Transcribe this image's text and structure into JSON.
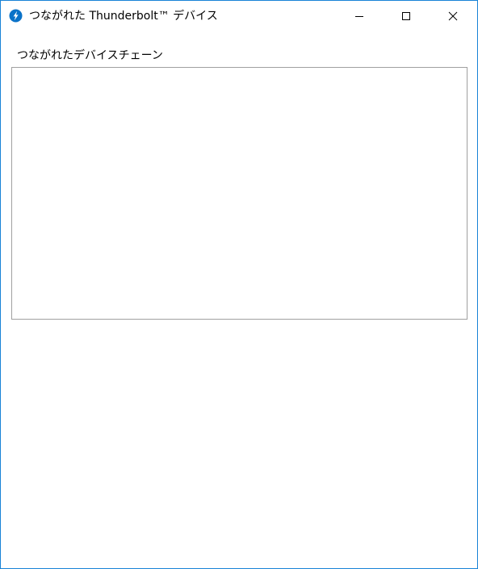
{
  "window": {
    "title": "つながれた Thunderbolt™ デバイス",
    "icon": "thunderbolt-icon",
    "accent_color": "#1883d7",
    "controls": {
      "minimize": "minimize-icon",
      "maximize": "maximize-icon",
      "close": "close-icon"
    }
  },
  "main": {
    "device_chain_label": "つながれたデバイスチェーン",
    "device_chain_items": []
  }
}
